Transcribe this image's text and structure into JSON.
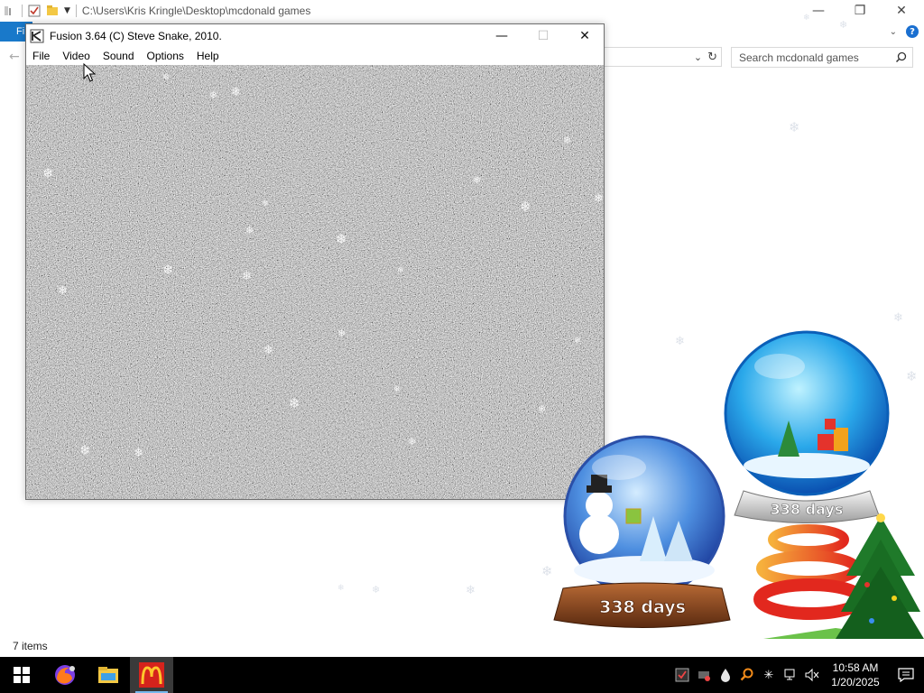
{
  "explorer": {
    "path": "C:\\Users\\Kris Kringle\\Desktop\\mcdonald games",
    "ribbon_file": "Fi",
    "search_placeholder": "Search mcdonald games",
    "status_items": "7 items"
  },
  "fusion": {
    "title": "Fusion 3.64 (C) Steve Snake, 2010.",
    "menu": [
      {
        "label": "File"
      },
      {
        "label": "Video"
      },
      {
        "label": "Sound"
      },
      {
        "label": "Options"
      },
      {
        "label": "Help"
      }
    ]
  },
  "globes": {
    "back_label": "338 days",
    "front_label": "338 days"
  },
  "taskbar": {
    "apps": [
      {
        "name": "firefox"
      },
      {
        "name": "file-explorer"
      },
      {
        "name": "mcdonalds-app",
        "active": true
      }
    ],
    "clock_time": "10:58 AM",
    "clock_date": "1/20/2025"
  },
  "colors": {
    "accent": "#1979ca",
    "taskbar": "#000000",
    "screen_noise": "#8e8e8e"
  }
}
